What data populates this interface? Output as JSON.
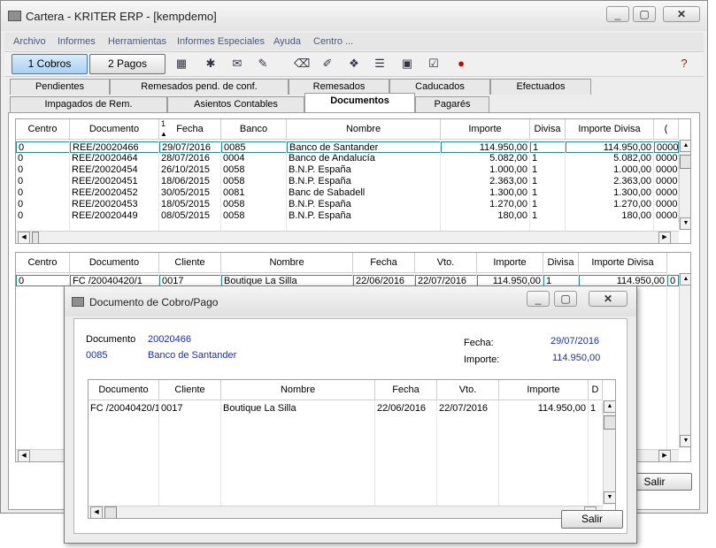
{
  "window": {
    "title": "Cartera - KRITER ERP - [kempdemo]",
    "icon": "folder-icon"
  },
  "menu": [
    "Archivo",
    "Informes",
    "Herramientas",
    "Informes Especiales",
    "Ayuda",
    "Centro ..."
  ],
  "toolbar": {
    "cobros_label": "1 Cobros",
    "pagos_label": "2 Pagos"
  },
  "tabs_row1": [
    "Pendientes",
    "Remesados pend. de conf.",
    "Remesados",
    "Caducados",
    "Efectuados"
  ],
  "tabs_row2": [
    "Impagados de Rem.",
    "Asientos Contables",
    "Documentos",
    "Pagarés"
  ],
  "active_tab": "Documentos",
  "top_grid": {
    "sort_indicator": "1",
    "columns": [
      "Centro",
      "Documento",
      "Fecha",
      "Banco",
      "Nombre",
      "Importe",
      "Divisa",
      "Importe Divisa",
      "("
    ],
    "rows": [
      [
        "0",
        "REE/20020466",
        "29/07/2016",
        "0085",
        "Banco de Santander",
        "114.950,00",
        "1",
        "114.950,00",
        "0000"
      ],
      [
        "0",
        "REE/20020464",
        "28/07/2016",
        "0004",
        "Banco de Andalucía",
        "5.082,00",
        "1",
        "5.082,00",
        "0000"
      ],
      [
        "0",
        "REE/20020454",
        "26/10/2015",
        "0058",
        "B.N.P. España",
        "1.000,00",
        "1",
        "1.000,00",
        "0000"
      ],
      [
        "0",
        "REE/20020451",
        "18/06/2015",
        "0058",
        "B.N.P. España",
        "2.363,00",
        "1",
        "2.363,00",
        "0000"
      ],
      [
        "0",
        "REE/20020452",
        "30/05/2015",
        "0081",
        "Banc de Sabadell",
        "1.300,00",
        "1",
        "1.300,00",
        "0000"
      ],
      [
        "0",
        "REE/20020453",
        "18/05/2015",
        "0058",
        "B.N.P. España",
        "1.270,00",
        "1",
        "1.270,00",
        "0000"
      ],
      [
        "0",
        "REE/20020449",
        "08/05/2015",
        "0058",
        "B.N.P. España",
        "180,00",
        "1",
        "180,00",
        "0000"
      ]
    ]
  },
  "bottom_grid": {
    "columns": [
      "Centro",
      "Documento",
      "Cliente",
      "Nombre",
      "Fecha",
      "Vto.",
      "Importe",
      "Divisa",
      "Importe Divisa"
    ],
    "rows": [
      [
        "0",
        "FC /20040420/1",
        "0017",
        "Boutique La Silla",
        "22/06/2016",
        "22/07/2016",
        "114.950,00",
        "1",
        "114.950,00",
        "0"
      ]
    ],
    "salir_label": "Salir"
  },
  "dialog": {
    "title": "Documento de Cobro/Pago",
    "documento_label": "Documento",
    "documento_value": "20020466",
    "banco_code": "0085",
    "banco_name": "Banco de Santander",
    "fecha_label": "Fecha:",
    "fecha_value": "29/07/2016",
    "importe_label": "Importe:",
    "importe_value": "114.950,00",
    "columns": [
      "Documento",
      "Cliente",
      "Nombre",
      "Fecha",
      "Vto.",
      "Importe",
      "D"
    ],
    "rows": [
      [
        "FC /20040420/1",
        "0017",
        "Boutique La Silla",
        "22/06/2016",
        "22/07/2016",
        "114.950,00",
        "1"
      ]
    ],
    "salir_label": "Salir"
  },
  "colors": {
    "selection_border": "#2d8a8f",
    "dialog_value_blue": "#1c2fa8",
    "menu_text": "#4a5a7a"
  }
}
